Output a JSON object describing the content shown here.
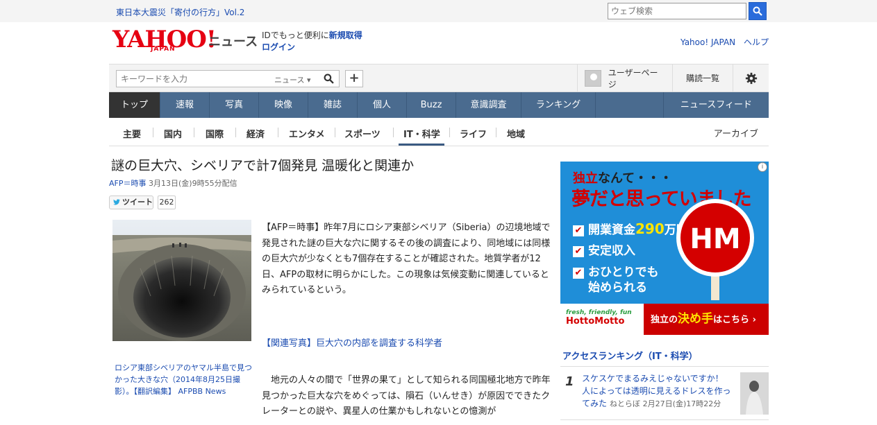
{
  "topbar": {
    "link": "東日本大震災「寄付の行方」Vol.2",
    "search_placeholder": "ウェブ検索"
  },
  "header": {
    "logo": "YAHOO!",
    "logo_sub": "JAPAN",
    "section": "ニュース",
    "id_prefix": "IDでもっと便利に",
    "signup": "新規取得",
    "login": "ログイン",
    "links": [
      "Yahoo! JAPAN",
      "ヘルプ"
    ]
  },
  "toolbar": {
    "keyword_placeholder": "キーワードを入力",
    "scope": "ニュース",
    "user_page": "ユーザーページ",
    "subscriptions": "購読一覧"
  },
  "main_nav": {
    "items": [
      "トップ",
      "速報",
      "写真",
      "映像",
      "雑誌",
      "個人",
      "Buzz",
      "意識調査",
      "ランキング"
    ],
    "feed": "ニュースフィード",
    "active": "トップ"
  },
  "sub_nav": {
    "items": [
      "主要",
      "国内",
      "国際",
      "経済",
      "エンタメ",
      "スポーツ",
      "IT・科学",
      "ライフ",
      "地域"
    ],
    "active": "IT・科学",
    "archive": "アーカイブ"
  },
  "article": {
    "title": "謎の巨大穴、シベリアで計7個発見 温暖化と関連か",
    "source": "AFP＝時事",
    "date": "3月13日(金)9時55分配信",
    "tweet_label": "ツイート",
    "tweet_count": "262",
    "photo_caption": "ロシア東部シベリアのヤマル半島で見つかった大きな穴（2014年8月25日撮影）。【翻訳編集】 AFPBB News",
    "paragraph1": "【AFP＝時事】昨年7月にロシア東部シベリア（Siberia）の辺境地域で発見された謎の巨大な穴に関するその後の調査により、同地域には同様の巨大穴が少なくとも7個存在することが確認された。地質学者が12日、AFPの取材に明らかにした。この現象は気候変動に関連しているとみられているという。",
    "related": "【関連写真】巨大穴の内部を調査する科学者",
    "paragraph2": "地元の人々の間で「世界の果て」として知られる同国極北地方で昨年見つかった巨大な穴をめぐっては、隕石（いんせき）が原因でできたクレーターとの説や、異星人の仕業かもしれないとの憶測が"
  },
  "ad": {
    "head_red": "独立",
    "head_black": "なんて・・・",
    "big": "夢だと思っていました",
    "line1_prefix": "開業資金",
    "line1_amount": "290",
    "line1_suffix": "万円",
    "line2": "安定収入",
    "line3a": "おひとりでも",
    "line3b": "始められる",
    "check": "✔",
    "brand_tag": "fresh, friendly, fun",
    "brand": "HottoMotto",
    "cta_prefix": "独立の",
    "cta_em": "決め手",
    "cta_suffix": "はこちら",
    "info": "i"
  },
  "ranking": {
    "title": "アクセスランキング（IT・科学）",
    "items": [
      {
        "rank": "1",
        "title": "スケスケでまるみえじゃないですか！ 人によっては透明に見えるドレスを作ってみた",
        "source": "ねとらぼ",
        "date": "2月27日(金)17時22分"
      }
    ]
  }
}
